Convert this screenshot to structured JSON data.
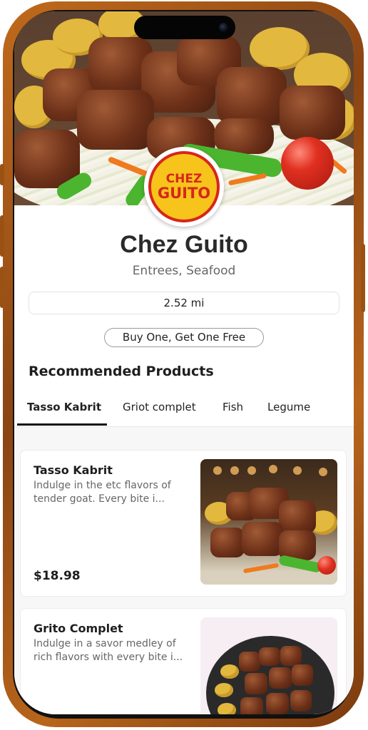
{
  "restaurant": {
    "logo_line1": "CHEZ",
    "logo_line2": "GUITO",
    "name": "Chez Guito",
    "categories": "Entrees, Seafood",
    "distance": "2.52 mi",
    "promo": "Buy One, Get One Free"
  },
  "section": {
    "title": "Recommended Products"
  },
  "tabs": [
    {
      "label": "Tasso Kabrit",
      "active": true
    },
    {
      "label": "Griot complet",
      "active": false
    },
    {
      "label": "Fish",
      "active": false
    },
    {
      "label": "Legume",
      "active": false
    }
  ],
  "products": [
    {
      "name": "Tasso Kabrit",
      "description_line1": "Indulge in the etc flavors of",
      "description_line2": "tender goat. Every bite i...",
      "price": "$18.98"
    },
    {
      "name": "Grito Complet",
      "description_line1": "Indulge in a savor medley of",
      "description_line2": "rich flavors with every bite i...",
      "price": ""
    }
  ],
  "colors": {
    "frame": "#b8651c",
    "logo_yellow": "#f6c41a",
    "logo_red": "#d7261c",
    "text_dark": "#1e1e1e"
  }
}
